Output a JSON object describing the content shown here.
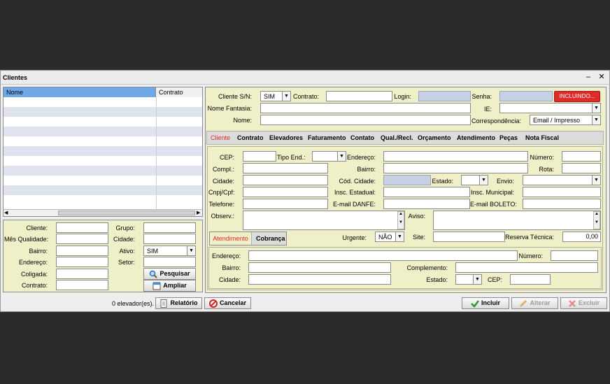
{
  "window": {
    "title": "Clientes",
    "minimize": "–",
    "close": "✕"
  },
  "grid": {
    "columns": [
      "Nome",
      "Contrato"
    ],
    "rows": 11
  },
  "filters": {
    "cliente": "Cliente:",
    "grupo": "Grupo:",
    "mes_qualidade": "Mês Qualidade:",
    "cidade": "Cidade:",
    "bairro": "Bairro:",
    "ativo": "Ativo:",
    "ativo_value": "SIM",
    "endereco": "Endereço:",
    "setor": "Setor:",
    "coligada": "Coligada:",
    "contrato": "Contrato:",
    "pesquisar": "Pesquisar",
    "ampliar": "Ampliar"
  },
  "header": {
    "cliente_sn": "Cliente S/N:",
    "cliente_sn_value": "SIM",
    "contrato": "Contrato:",
    "login": "Login:",
    "senha": "Senha:",
    "status": "INCLUINDO...",
    "nome_fantasia": "Nome Fantasia:",
    "ie": "IE:",
    "nome": "Nome:",
    "correspondencia": "Correspondência:",
    "correspondencia_value": "Email / Impresso"
  },
  "tabs": [
    "Cliente",
    "Contrato",
    "Elevadores",
    "Faturamento",
    "Contato",
    "Qual./Recl.",
    "Orçamento",
    "Atendimento",
    "Peças",
    "Nota Fiscal"
  ],
  "form": {
    "cep": "CEP:",
    "tipo_end": "Tipo End.:",
    "endereco": "Endereço:",
    "numero": "Número:",
    "compl": "Compl.:",
    "bairro": "Bairro:",
    "rota": "Rota:",
    "cidade": "Cidade:",
    "cod_cidade": "Cód. Cidade:",
    "estado": "Estado:",
    "envio": "Envio:",
    "cnpj": "Cnpj/Cpf:",
    "insc_estadual": "Insc. Estadual:",
    "insc_municipal": "Insc. Municipal:",
    "telefone": "Telefone:",
    "email_danfe": "E-mail DANFE:",
    "email_boleto": "E-mail BOLETO:",
    "observ": "Observ.:",
    "aviso": "Aviso:",
    "urgente": "Urgente:",
    "urgente_value": "NÃO",
    "site": "Site:",
    "reserva": "Reserva Técnica:",
    "reserva_value": "0,00"
  },
  "subtabs": [
    "Atendimento",
    "Cobrança"
  ],
  "sub": {
    "endereco": "Endereço:",
    "numero": "Número:",
    "bairro": "Bairro:",
    "complemento": "Complemento:",
    "cidade": "Cidade:",
    "estado": "Estado:",
    "cep": "CEP:"
  },
  "footer": {
    "count": "0 elevador(es).",
    "relatorio": "Relatório",
    "cancelar": "Cancelar",
    "incluir": "Incluir",
    "alterar": "Alterar",
    "excluir": "Excluir"
  },
  "colors": {
    "status_bg": "#e02a2a",
    "active_tab": "#e02a2a",
    "grid_header": "#6fa8e6"
  }
}
